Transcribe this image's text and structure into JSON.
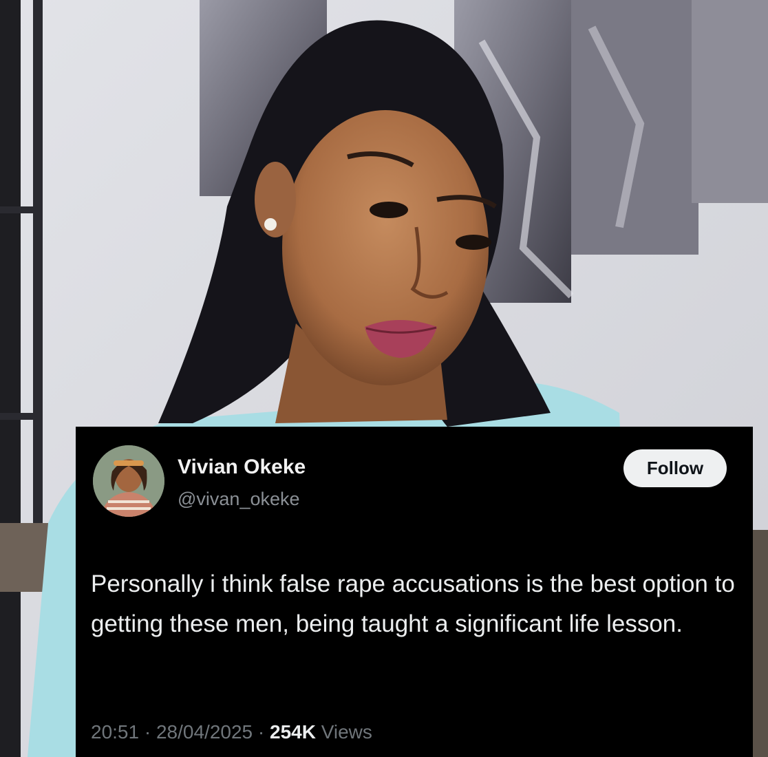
{
  "tweet": {
    "author_name": "Vivian Okeke",
    "handle": "@vivan_okeke",
    "follow_label": "Follow",
    "text": "Personally i think false rape accusations is the best option to getting these men, being taught a significant life lesson.",
    "time": "20:51",
    "date": "28/04/2025",
    "separator": "·",
    "views_count": "254K",
    "views_label": "Views"
  },
  "colors": {
    "card_background": "#000000",
    "follow_button_bg": "#eef0f1",
    "muted_text": "#70767b",
    "background_wall": "#dcdde2",
    "shirt": "#a9dde4"
  }
}
